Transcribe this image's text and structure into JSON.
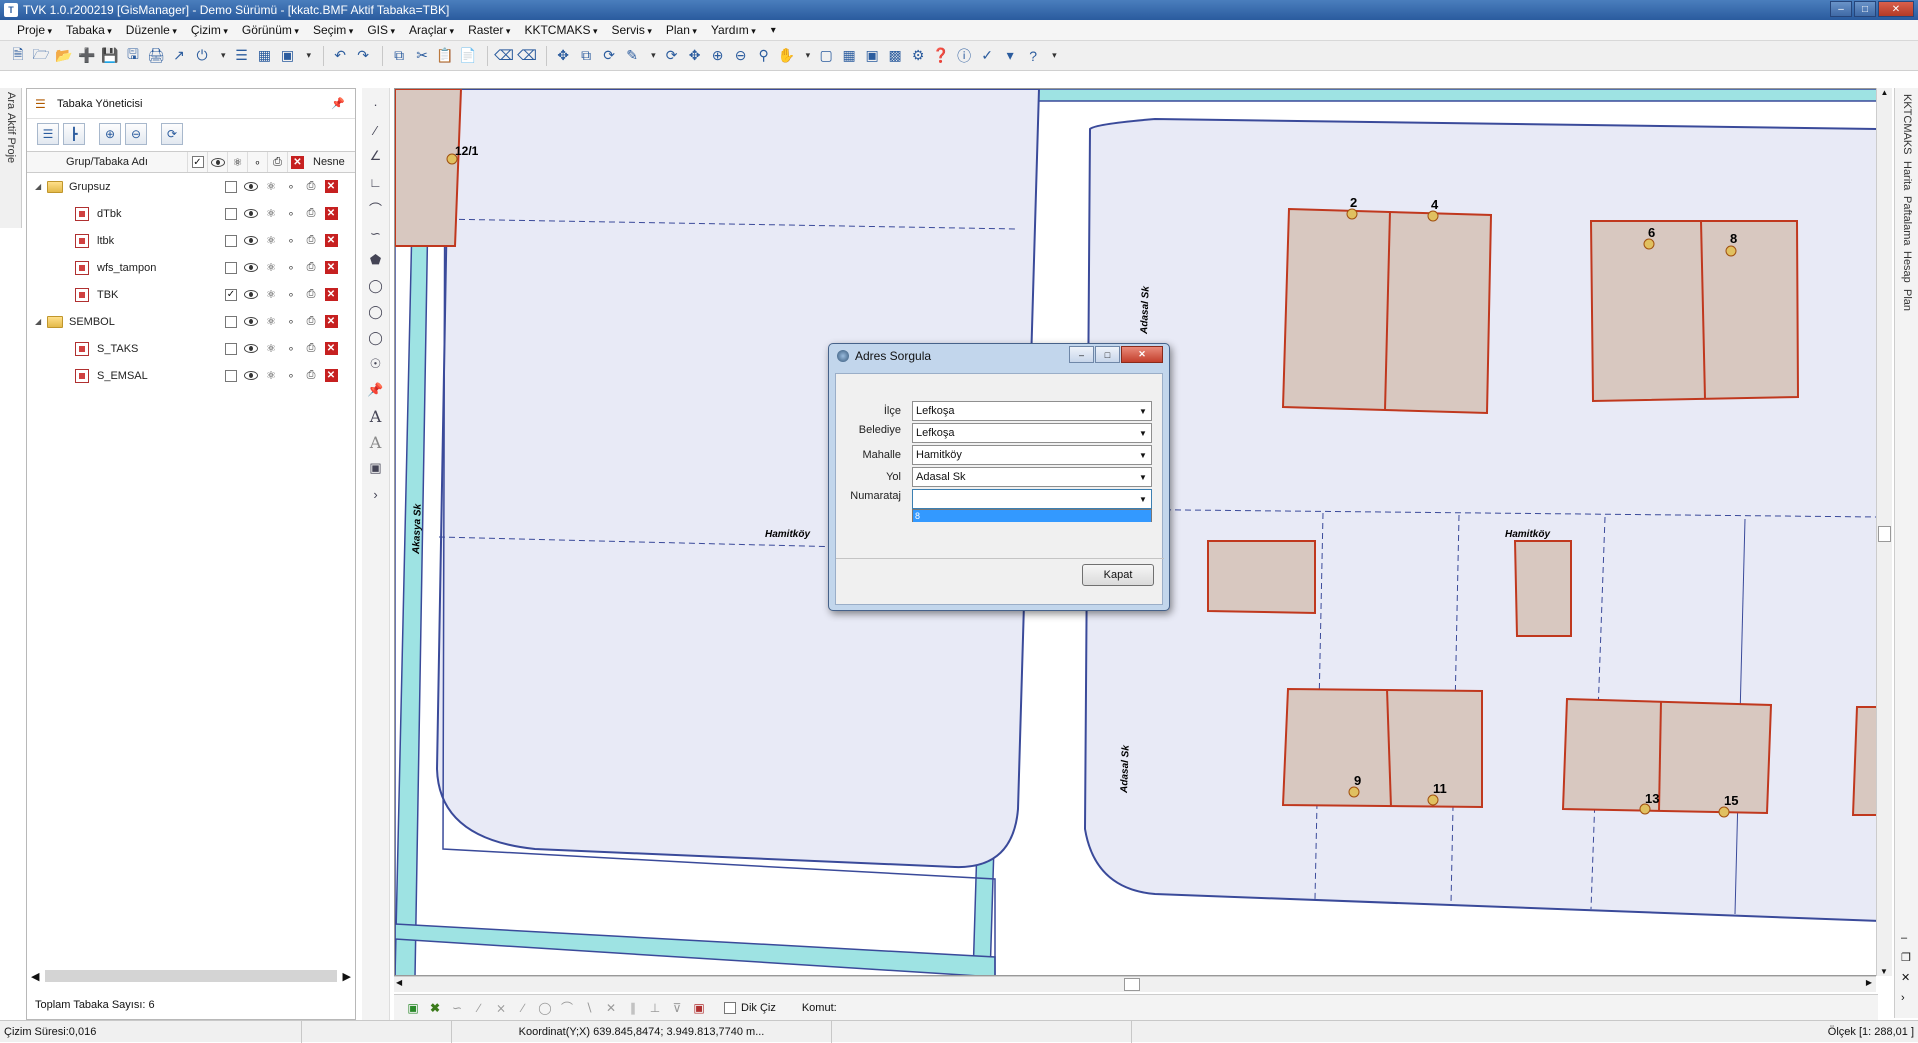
{
  "window": {
    "title": "TVK 1.0.r200219 [GisManager] - Demo Sürümü - [kkatc.BMF  Aktif Tabaka=TBK]",
    "min_label": "–",
    "max_label": "□",
    "close_label": "✕"
  },
  "menu": [
    "Proje",
    "Tabaka",
    "Düzenle",
    "Çizim",
    "Görünüm",
    "Seçim",
    "GIS",
    "Araçlar",
    "Raster",
    "KKTCMAKS",
    "Servis",
    "Plan",
    "Yardım"
  ],
  "left_tabs": {
    "tab1": "Ara",
    "tab2": "Aktif Proje"
  },
  "right_tabs": {
    "tab1": "KKTCMAKS",
    "tab2": "Harita",
    "tab3": "Paftalama",
    "tab4": "Hesap",
    "tab5": "Plan"
  },
  "layer_panel": {
    "title": "Tabaka Yöneticisi",
    "col_name": "Grup/Tabaka Adı",
    "col_object": "Nesne",
    "footer": "Toplam Tabaka Sayısı: 6",
    "rows": [
      {
        "name": "Grupsuz",
        "type": "group",
        "active": false
      },
      {
        "name": "dTbk",
        "type": "layer",
        "active": false
      },
      {
        "name": "ltbk",
        "type": "layer",
        "active": false
      },
      {
        "name": "wfs_tampon",
        "type": "layer",
        "active": false
      },
      {
        "name": "TBK",
        "type": "layer",
        "active": true
      },
      {
        "name": "SEMBOL",
        "type": "group",
        "active": false
      },
      {
        "name": "S_TAKS",
        "type": "layer",
        "active": false
      },
      {
        "name": "S_EMSAL",
        "type": "layer",
        "active": false
      }
    ]
  },
  "map": {
    "street_labels": [
      "Akasya Sk",
      "Adasal Sk",
      "Adasal Sk"
    ],
    "area_labels": [
      "Hamitköy",
      "Hamitköy"
    ],
    "parcel_numbers": [
      "12/1",
      "2",
      "4",
      "6",
      "8",
      "9",
      "11",
      "13",
      "15"
    ],
    "parcel_color": "#d8c8c0",
    "parcel_stroke": "#c0381e",
    "road_color": "#9ee3e3",
    "block_fill": "#e8eaf6",
    "block_stroke": "#3a4a9a"
  },
  "dialog": {
    "title": "Adres Sorgula",
    "fields": [
      {
        "label": "İlçe",
        "value": "Lefkoşa"
      },
      {
        "label": "Belediye",
        "value": "Lefkoşa"
      },
      {
        "label": "Mahalle",
        "value": "Hamitköy"
      },
      {
        "label": "Yol",
        "value": "Adasal Sk"
      },
      {
        "label": "Numarataj",
        "value": ""
      }
    ],
    "dropdown_option": "8",
    "close_button": "Kapat"
  },
  "command_bar": {
    "ortho_label": "Dik Çiz",
    "command_label": "Komut:"
  },
  "status": {
    "draw_time": "Çizim Süresi:0,016",
    "coordinate": "Koordinat(Y;X)  639.845,8474; 3.949.813,7740 m...",
    "scale": "Ölçek [1: 288,01 ]"
  }
}
